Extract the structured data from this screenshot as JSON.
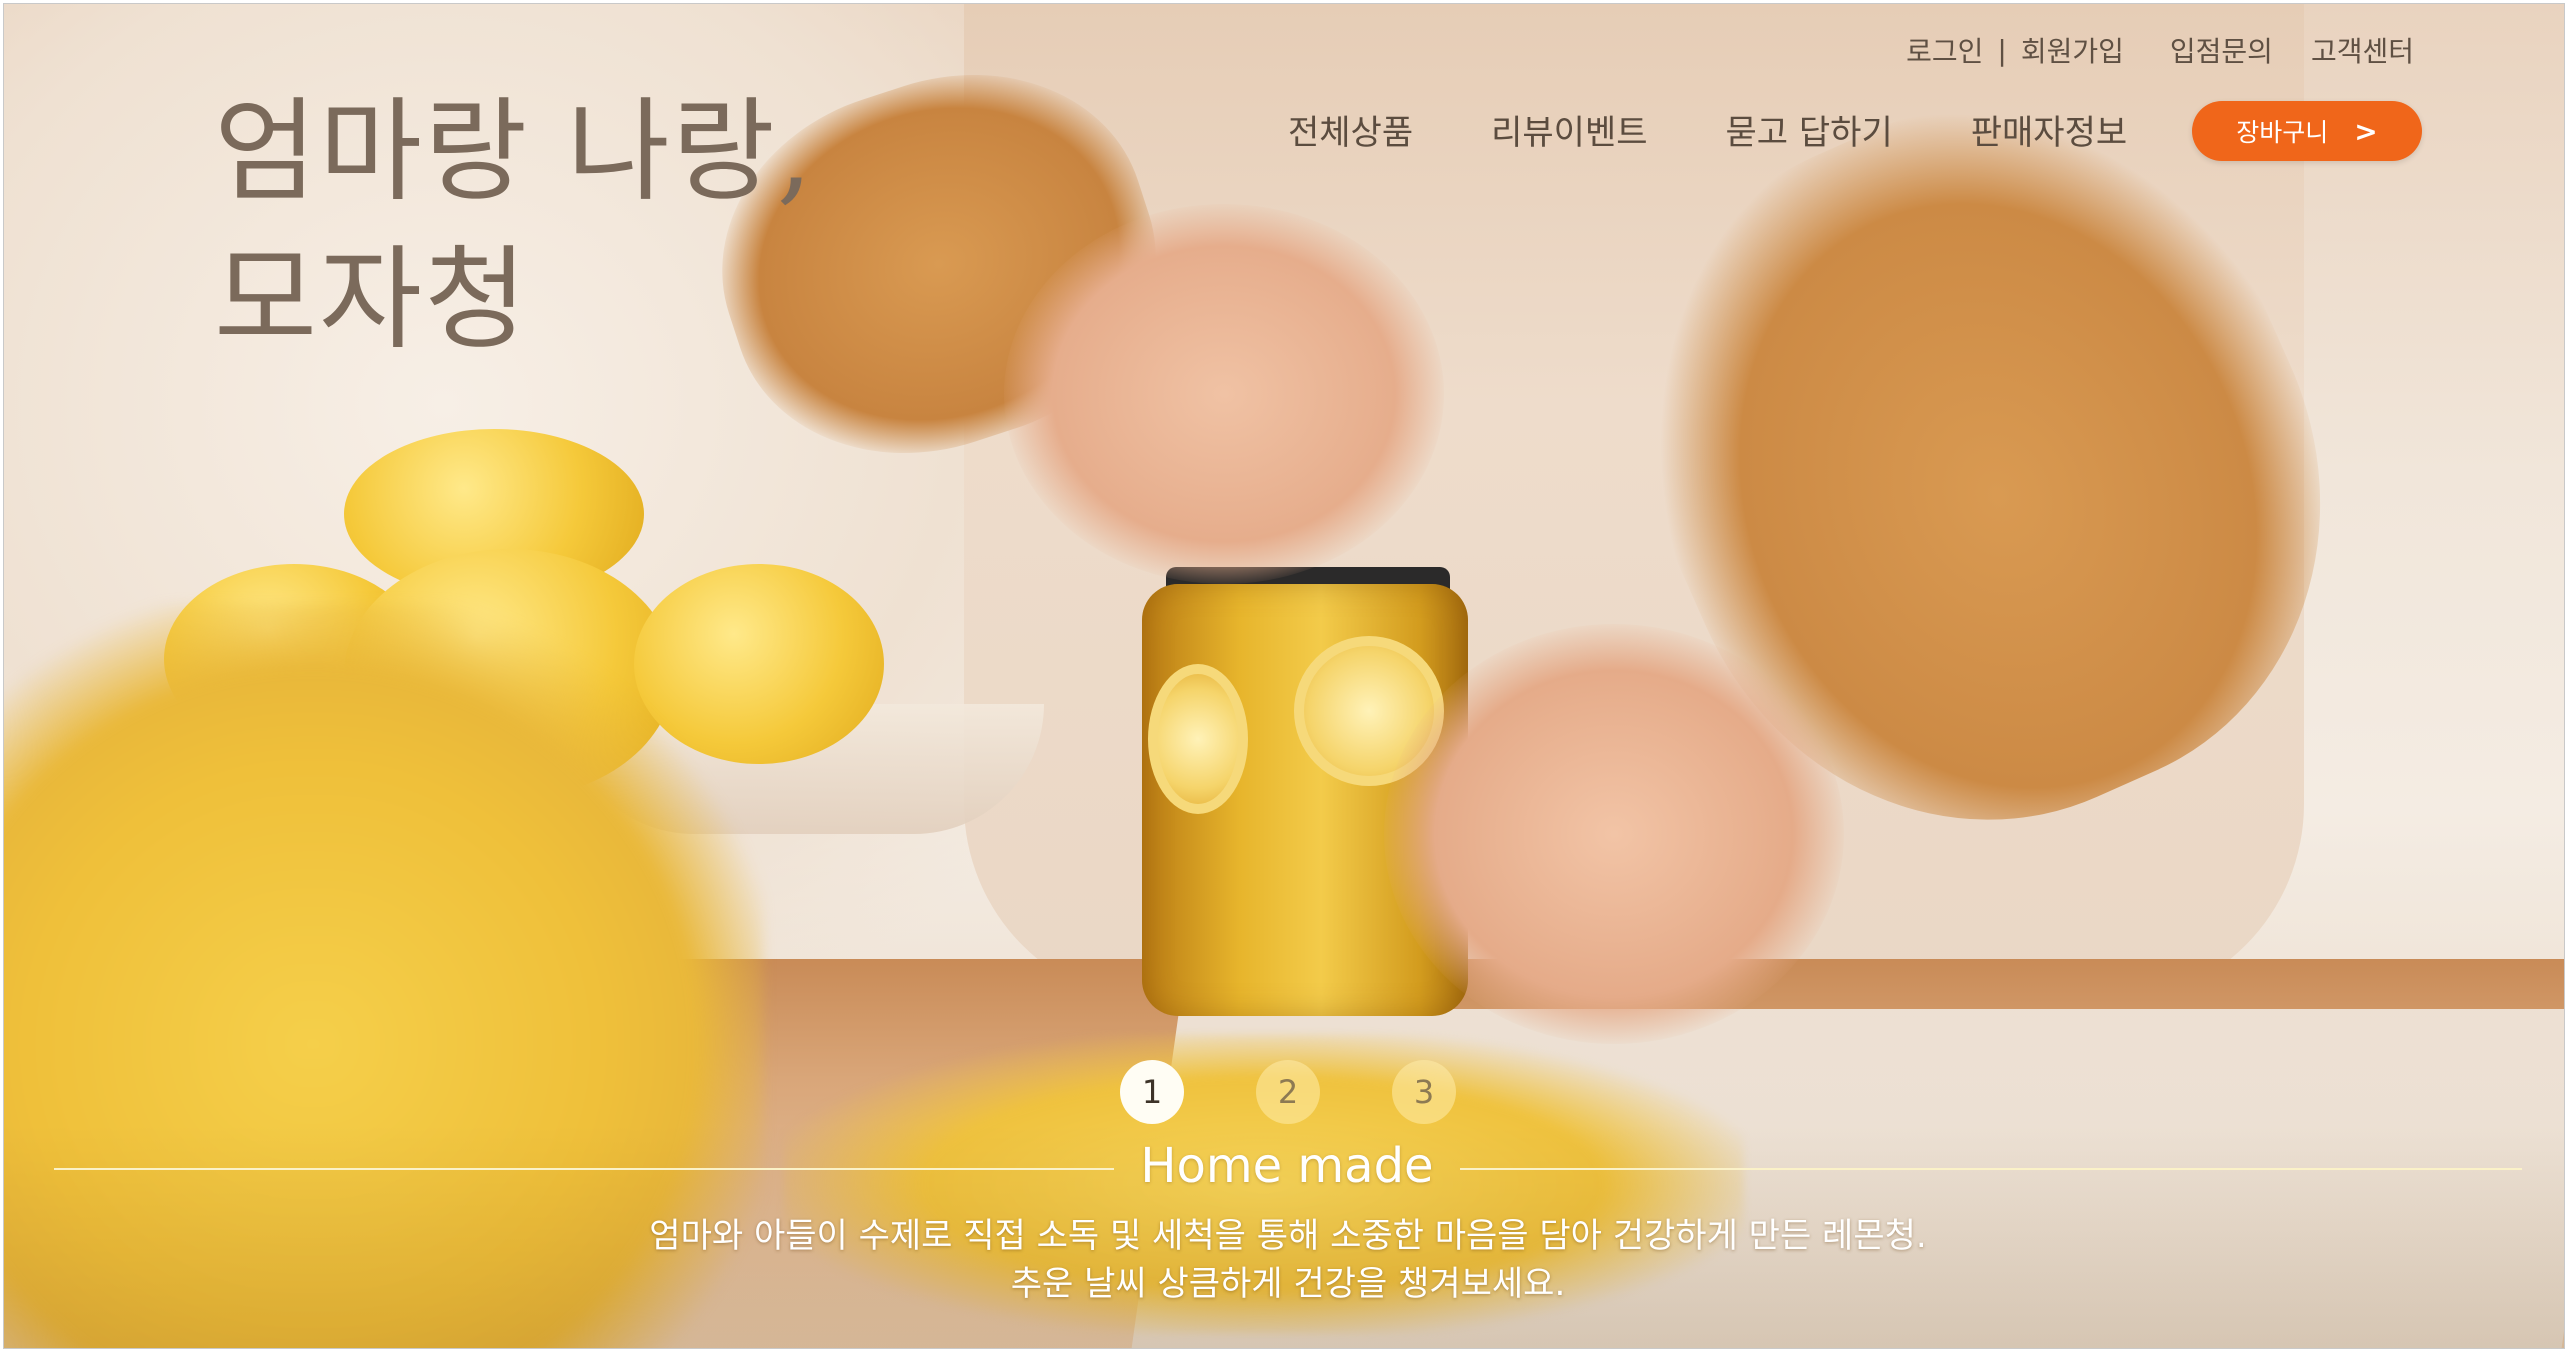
{
  "brand": {
    "line1": "엄마랑 나랑,",
    "line2": "모자청"
  },
  "utility": {
    "login": "로그인",
    "separator": "|",
    "signup": "회원가입",
    "partner": "입점문의",
    "support": "고객센터"
  },
  "nav": {
    "items": [
      "전체상품",
      "리뷰이벤트",
      "묻고 답하기",
      "판매자정보"
    ]
  },
  "cart": {
    "label": "장바구니",
    "chevron": ">"
  },
  "slider": {
    "pages": [
      "1",
      "2",
      "3"
    ],
    "active_index": 0
  },
  "hero": {
    "tagline": "Home made",
    "description_line1": "엄마와 아들이 수제로 직접 소독 및 세척을 통해 소중한 마음을 담아 건강하게 만든 레몬청.",
    "description_line2": "추운 날씨 상큼하게 건강을 챙겨보세요."
  },
  "colors": {
    "accent": "#f0661a",
    "brand_text": "#7b6a5b",
    "nav_text": "#5b4c3f",
    "rule": "#fbf2c8"
  }
}
